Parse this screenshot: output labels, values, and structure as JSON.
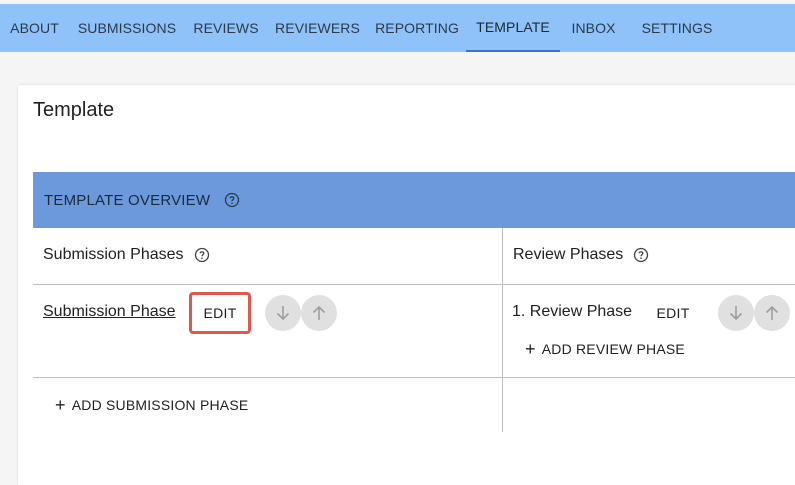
{
  "nav": {
    "tabs": [
      {
        "label": "ABOUT"
      },
      {
        "label": "SUBMISSIONS"
      },
      {
        "label": "REVIEWS"
      },
      {
        "label": "REVIEWERS"
      },
      {
        "label": "REPORTING"
      },
      {
        "label": "TEMPLATE",
        "active": true
      },
      {
        "label": "INBOX"
      },
      {
        "label": "SETTINGS"
      }
    ]
  },
  "page": {
    "title": "Template"
  },
  "overview": {
    "title": "TEMPLATE OVERVIEW",
    "help_icon": "help-circle-icon"
  },
  "submission_phases": {
    "heading": "Submission Phases",
    "items": [
      {
        "name": "Submission Phase",
        "edit_label": "EDIT"
      }
    ],
    "add_label": "ADD SUBMISSION PHASE"
  },
  "review_phases": {
    "heading": "Review Phases",
    "items": [
      {
        "name": "1. Review Phase",
        "edit_label": "EDIT"
      }
    ],
    "add_label": "ADD REVIEW PHASE"
  },
  "colors": {
    "nav_bg": "#8ec2f9",
    "header_bg": "#6b99dc",
    "highlight": "#e0584c",
    "round_button": "#e0e0e0"
  },
  "icons": {
    "move_down": "arrow-down-icon",
    "move_up": "arrow-up-icon",
    "add": "plus-icon"
  }
}
